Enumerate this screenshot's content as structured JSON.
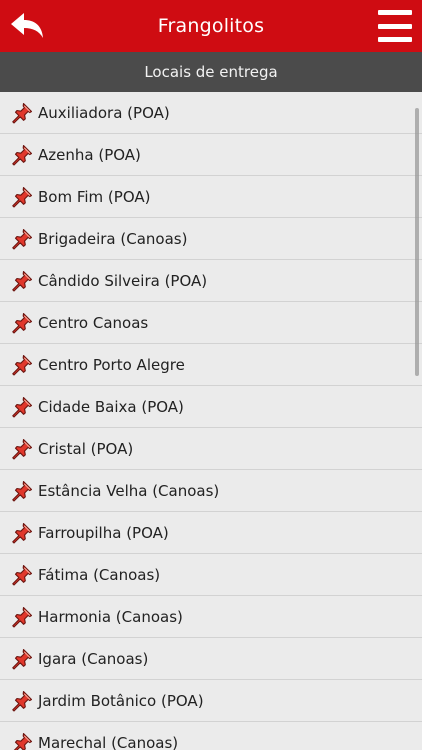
{
  "colors": {
    "header": "#cf0c12",
    "subheader": "#4b4b4b",
    "pin": "#e0372b"
  },
  "header": {
    "title": "Frangolitos",
    "back_icon": "back-arrow-icon",
    "menu_icon": "hamburger-menu-icon"
  },
  "subheader": {
    "title": "Locais de entrega"
  },
  "list": {
    "items": [
      {
        "label": "Auxiliadora (POA)"
      },
      {
        "label": "Azenha (POA)"
      },
      {
        "label": "Bom Fim (POA)"
      },
      {
        "label": "Brigadeira (Canoas)"
      },
      {
        "label": "Cândido Silveira (POA)"
      },
      {
        "label": "Centro Canoas"
      },
      {
        "label": "Centro Porto Alegre"
      },
      {
        "label": "Cidade Baixa (POA)"
      },
      {
        "label": "Cristal (POA)"
      },
      {
        "label": "Estância Velha (Canoas)"
      },
      {
        "label": "Farroupilha (POA)"
      },
      {
        "label": "Fátima (Canoas)"
      },
      {
        "label": "Harmonia (Canoas)"
      },
      {
        "label": "Igara (Canoas)"
      },
      {
        "label": "Jardim Botânico (POA)"
      },
      {
        "label": "Marechal (Canoas)"
      }
    ]
  }
}
